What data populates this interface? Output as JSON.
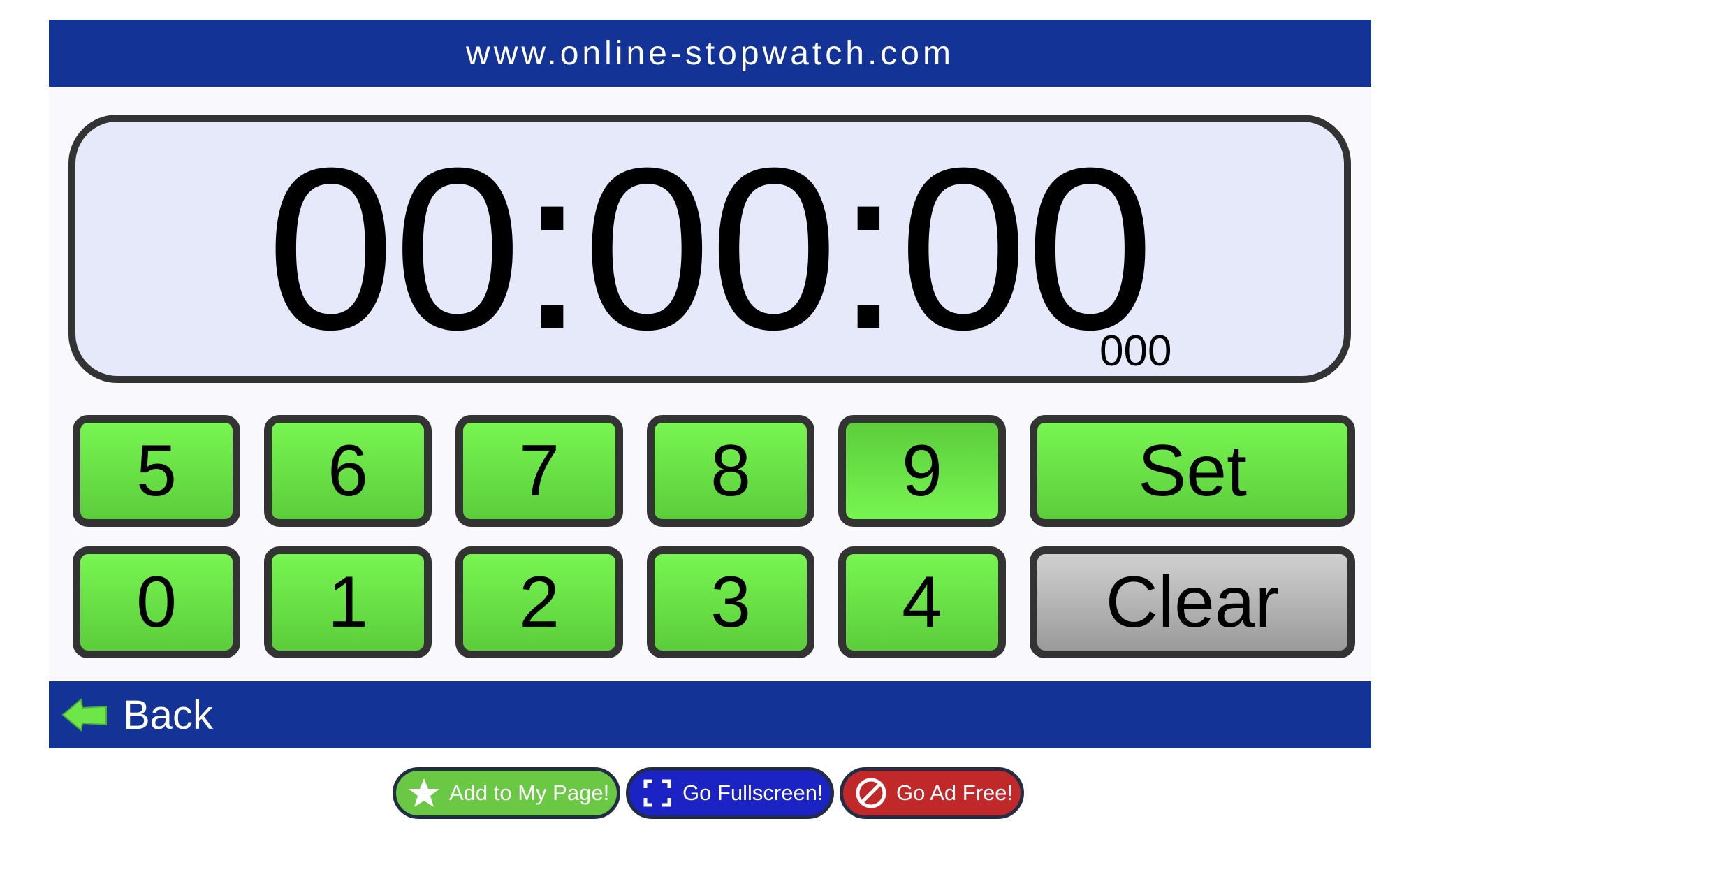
{
  "header": {
    "title": "www.online-stopwatch.com"
  },
  "display": {
    "time": "00:00:00",
    "milliseconds": "000"
  },
  "keypad": {
    "row1": [
      "5",
      "6",
      "7",
      "8",
      "9"
    ],
    "row2": [
      "0",
      "1",
      "2",
      "3",
      "4"
    ],
    "set_label": "Set",
    "clear_label": "Clear"
  },
  "footer": {
    "back_label": "Back",
    "back_icon": "arrow-left-icon"
  },
  "actions": {
    "add_label": "Add to My Page!",
    "add_icon": "star-icon",
    "fullscreen_label": "Go Fullscreen!",
    "fullscreen_icon": "fullscreen-icon",
    "adfree_label": "Go Ad Free!",
    "adfree_icon": "no-ads-icon"
  },
  "colors": {
    "banner": "#143397",
    "display_bg": "#e6e9fa",
    "key_green": "#6ee64a",
    "key_gray": "#bdbdbd",
    "add_green": "#6bc845",
    "fullscreen_blue": "#1b23c4",
    "adfree_red": "#c0282a"
  }
}
